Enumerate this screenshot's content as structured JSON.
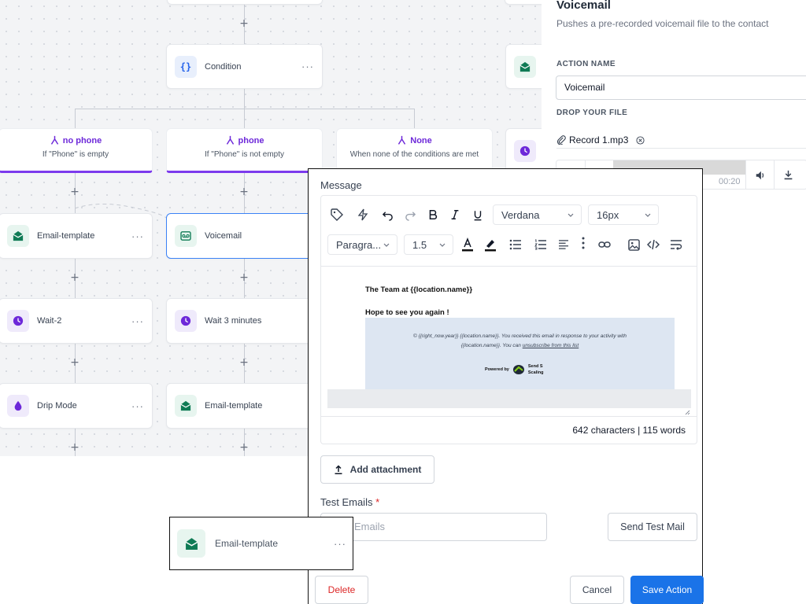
{
  "canvas": {
    "condition_node": {
      "label": "Condition",
      "icon": "braces-icon"
    },
    "branches": [
      {
        "title": "no phone",
        "subtitle": "If \"Phone\" is empty"
      },
      {
        "title": "phone",
        "subtitle": "If \"Phone\" is not empty"
      },
      {
        "title": "None",
        "subtitle": "When none of the conditions are met"
      }
    ],
    "left_column": [
      {
        "label": "Email-template",
        "icon": "envelope-open-icon"
      },
      {
        "label": "Wait-2",
        "icon": "clock-icon"
      },
      {
        "label": "Drip Mode",
        "icon": "drop-icon"
      }
    ],
    "middle_column": [
      {
        "label": "Voicemail",
        "icon": "voicemail-icon"
      },
      {
        "label": "Wait 3 minutes",
        "icon": "clock-icon"
      },
      {
        "label": "Email-template",
        "icon": "envelope-open-icon"
      }
    ],
    "more_label": "···",
    "add_symbol": "+"
  },
  "side_panel": {
    "title": "Voicemail",
    "description": "Pushes a pre-recorded voicemail file to the contact",
    "action_name_label": "ACTION NAME",
    "action_name_value": "Voicemail",
    "drop_file_label": "DROP YOUR FILE",
    "file_name": "Record 1.mp3",
    "player_time": "00:20"
  },
  "dialog": {
    "message_label": "Message",
    "font_family": "Verdana",
    "font_size": "16px",
    "paragraph": "Paragra...",
    "line_height": "1.5",
    "email": {
      "line1": "The Team at {{location.name}}",
      "line2": "Hope to see you again !",
      "footer_line1": "© {{right_now.year}}  {{location.name}}. You received this email in response to your activity with",
      "footer_line2_a": "{{location.name}}. You can ",
      "footer_line2_link": "unsubscribe from this list",
      "powered_by": "Powered by",
      "brand_line1": "Send S",
      "brand_line2": "Scaling"
    },
    "counts": "642 characters | 115 words",
    "add_attachment": "Add attachment",
    "test_emails_label": "Test Emails",
    "required_mark": "*",
    "test_emails_placeholder": "Emails",
    "send_test_mail": "Send Test Mail",
    "delete": "Delete",
    "cancel": "Cancel",
    "save_action": "Save Action"
  },
  "drag_ghost": {
    "label": "Email-template",
    "icon": "envelope-open-icon"
  },
  "colors": {
    "accent": "#1a73e8",
    "branch": "#7c3aed",
    "danger": "#dc2626",
    "email_green": "#0f7b55"
  }
}
